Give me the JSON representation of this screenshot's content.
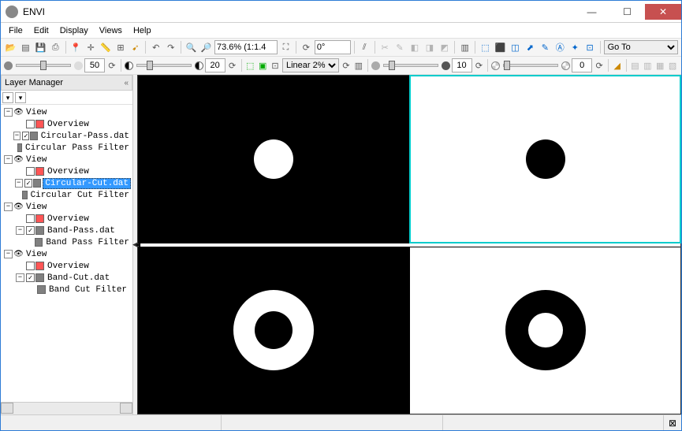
{
  "app": {
    "title": "ENVI"
  },
  "menu": {
    "items": [
      "File",
      "Edit",
      "Display",
      "Views",
      "Help"
    ]
  },
  "toolbar1": {
    "zoom": "73.6% (1:1.4",
    "rotation": "0°",
    "goto": "Go To"
  },
  "toolbar2": {
    "brightness": "50",
    "contrast": "20",
    "stretch": "Linear 2%",
    "sharpen": "10",
    "transparency": "0"
  },
  "layer_panel": {
    "title": "Layer Manager",
    "views": [
      {
        "name": "View",
        "items": [
          {
            "label": "Overview",
            "type": "overview",
            "checked": false
          },
          {
            "label": "Circular-Pass.dat",
            "type": "raster",
            "checked": true
          },
          {
            "label": "Circular Pass Filter",
            "type": "filter"
          }
        ]
      },
      {
        "name": "View",
        "items": [
          {
            "label": "Overview",
            "type": "overview",
            "checked": false
          },
          {
            "label": "Circular-Cut.dat",
            "type": "raster",
            "checked": true,
            "selected": true
          },
          {
            "label": "Circular Cut Filter",
            "type": "filter"
          }
        ]
      },
      {
        "name": "View",
        "items": [
          {
            "label": "Overview",
            "type": "overview",
            "checked": false
          },
          {
            "label": "Band-Pass.dat",
            "type": "raster",
            "checked": true
          },
          {
            "label": "Band Pass Filter",
            "type": "filter"
          }
        ]
      },
      {
        "name": "View",
        "items": [
          {
            "label": "Overview",
            "type": "overview",
            "checked": false
          },
          {
            "label": "Band-Cut.dat",
            "type": "raster",
            "checked": true
          },
          {
            "label": "Band Cut Filter",
            "type": "filter"
          }
        ]
      }
    ]
  }
}
